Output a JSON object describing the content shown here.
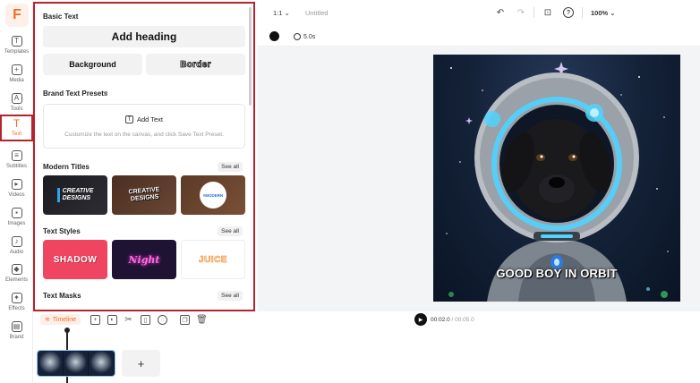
{
  "app": {
    "logo_letter": "F"
  },
  "rail": {
    "items": [
      {
        "label": "Templates",
        "icon": "T"
      },
      {
        "label": "Media",
        "icon": "+"
      },
      {
        "label": "Tools",
        "icon": "A"
      },
      {
        "label": "Text",
        "icon": "T"
      },
      {
        "label": "Subtitles",
        "icon": "≡"
      },
      {
        "label": "Videos",
        "icon": "▸"
      },
      {
        "label": "Images",
        "icon": "▪"
      },
      {
        "label": "Audio",
        "icon": "♪"
      },
      {
        "label": "Elements",
        "icon": "◆"
      },
      {
        "label": "Effects",
        "icon": "✦"
      },
      {
        "label": "Brand",
        "icon": "▤"
      }
    ]
  },
  "panel": {
    "basic_text": {
      "title": "Basic Text",
      "add_heading": "Add heading",
      "background": "Background",
      "border": "Border"
    },
    "brand_presets": {
      "title": "Brand Text Presets",
      "add_text": "Add Text",
      "hint": "Customize the text on the canvas, and click Save Text Preset."
    },
    "modern_titles": {
      "title": "Modern Titles",
      "see_all": "See all",
      "thumb1": "CREATIVE\nDESIGNS",
      "thumb2": "CREATIVE\nDESIGNS",
      "thumb3": "#MODERN"
    },
    "text_styles": {
      "title": "Text Styles",
      "see_all": "See all",
      "shadow": "SHADOW",
      "night": "Night",
      "juice": "JUICE"
    },
    "text_masks": {
      "title": "Text Masks",
      "see_all": "See all"
    }
  },
  "topbar": {
    "ratio": "1:1",
    "title": "Untitled",
    "zoom": "100%"
  },
  "subbar": {
    "duration": "5.0s"
  },
  "canvas": {
    "caption": "GOOD BOY IN ORBIT"
  },
  "timeline": {
    "label": "Timeline",
    "current_time": "00:02.0",
    "total_time": "/ 00:05.0",
    "add_clip": "+"
  }
}
